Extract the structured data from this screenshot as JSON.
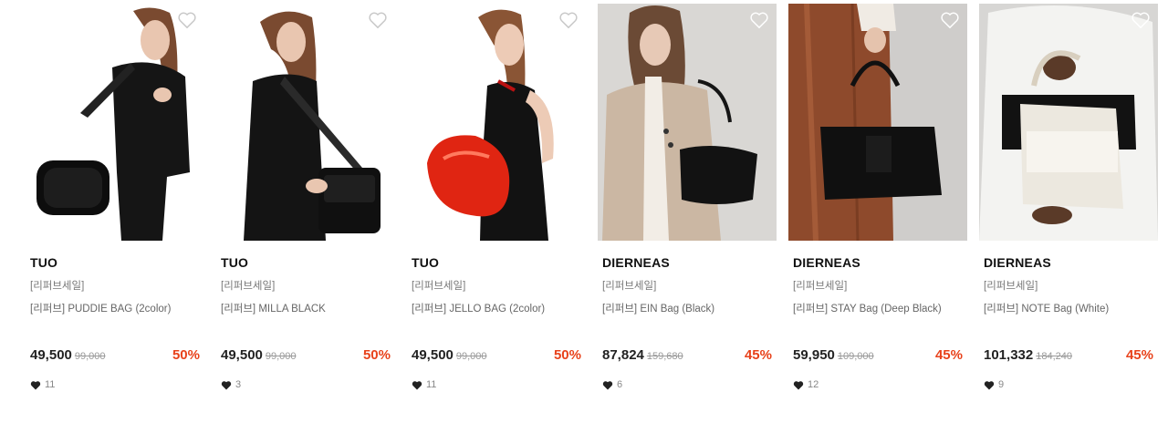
{
  "products": [
    {
      "brand": "TUO",
      "tag": "[리퍼브세일]",
      "name": "[리퍼브] PUDDIE BAG (2color)",
      "price": "49,500",
      "original_price": "99,000",
      "discount": "50%",
      "likes": "11",
      "image": "model-black-jacket-black-shoulder-bag",
      "bg": "#ffffff"
    },
    {
      "brand": "TUO",
      "tag": "[리퍼브세일]",
      "name": "[리퍼브] MILLA BLACK",
      "price": "49,500",
      "original_price": "99,000",
      "discount": "50%",
      "likes": "3",
      "image": "model-side-black-flap-bag",
      "bg": "#ffffff"
    },
    {
      "brand": "TUO",
      "tag": "[리퍼브세일]",
      "name": "[리퍼브] JELLO BAG (2color)",
      "price": "49,500",
      "original_price": "99,000",
      "discount": "50%",
      "likes": "11",
      "image": "model-red-patent-shoulder-bag",
      "bg": "#ffffff"
    },
    {
      "brand": "DIERNEAS",
      "tag": "[리퍼브세일]",
      "name": "[리퍼브] EIN Bag (Black)",
      "price": "87,824",
      "original_price": "159,680",
      "discount": "45%",
      "likes": "6",
      "image": "model-beige-jacket-black-bag",
      "bg": "#d9d7d4"
    },
    {
      "brand": "DIERNEAS",
      "tag": "[리퍼브세일]",
      "name": "[리퍼브] STAY Bag (Deep Black)",
      "price": "59,950",
      "original_price": "109,000",
      "discount": "45%",
      "likes": "12",
      "image": "brown-leather-skirt-black-handbag",
      "bg": "#cfcdcb"
    },
    {
      "brand": "DIERNEAS",
      "tag": "[리퍼브세일]",
      "name": "[리퍼브] NOTE Bag (White)",
      "price": "101,332",
      "original_price": "184,240",
      "discount": "45%",
      "likes": "9",
      "image": "model-white-shirt-white-tote",
      "bg": "#d7d6d4"
    }
  ],
  "colors": {
    "discount": "#e8421b",
    "price": "#222222",
    "muted": "#999999"
  },
  "icons": {
    "wishlist": "heart-outline-icon",
    "likes": "heart-filled-icon"
  }
}
